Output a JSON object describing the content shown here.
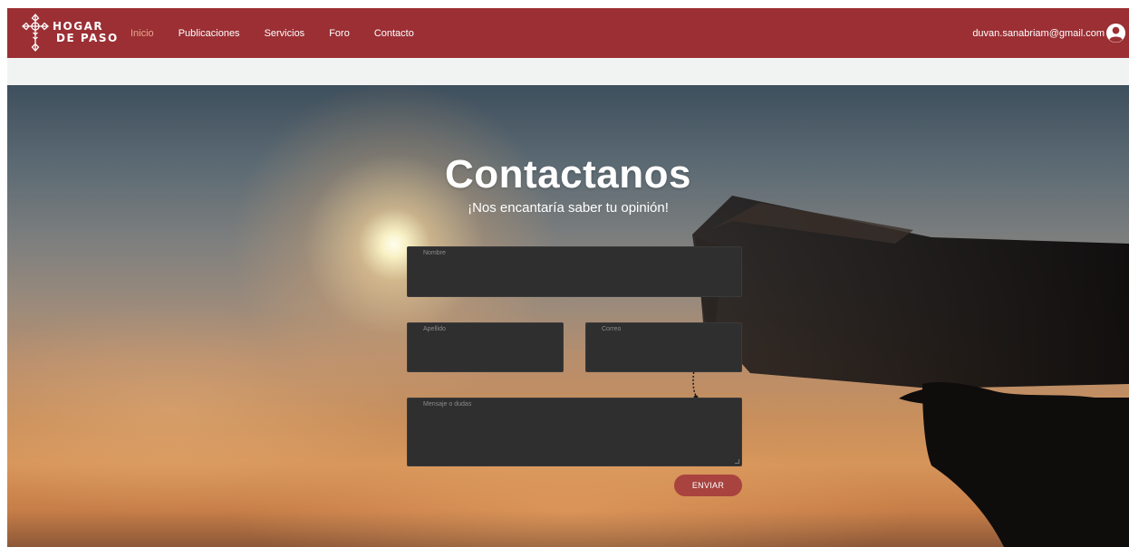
{
  "brand": {
    "line1": "HOGAR",
    "line2": "DE PASO",
    "icon": "cross-logo-icon"
  },
  "nav": {
    "items": [
      {
        "label": "Inicio",
        "active": true
      },
      {
        "label": "Publicaciones",
        "active": false
      },
      {
        "label": "Servicios",
        "active": false
      },
      {
        "label": "Foro",
        "active": false
      },
      {
        "label": "Contacto",
        "active": false
      }
    ],
    "active_color": "#e8a98e"
  },
  "user": {
    "email": "duvan.sanabriam@gmail.com",
    "icon": "user-avatar-icon"
  },
  "hero": {
    "title": "Contactanos",
    "subtitle": "¡Nos encantaría saber tu opinión!"
  },
  "form": {
    "nombre_label": "Nombre",
    "apellido_label": "Apellido",
    "correo_label": "Correo",
    "mensaje_label": "Mensaje o dudas",
    "submit_label": "ENVIAR"
  },
  "colors": {
    "navbar": "#9b2f34",
    "button": "#a8433f",
    "field_bg": "#2f2f30"
  }
}
